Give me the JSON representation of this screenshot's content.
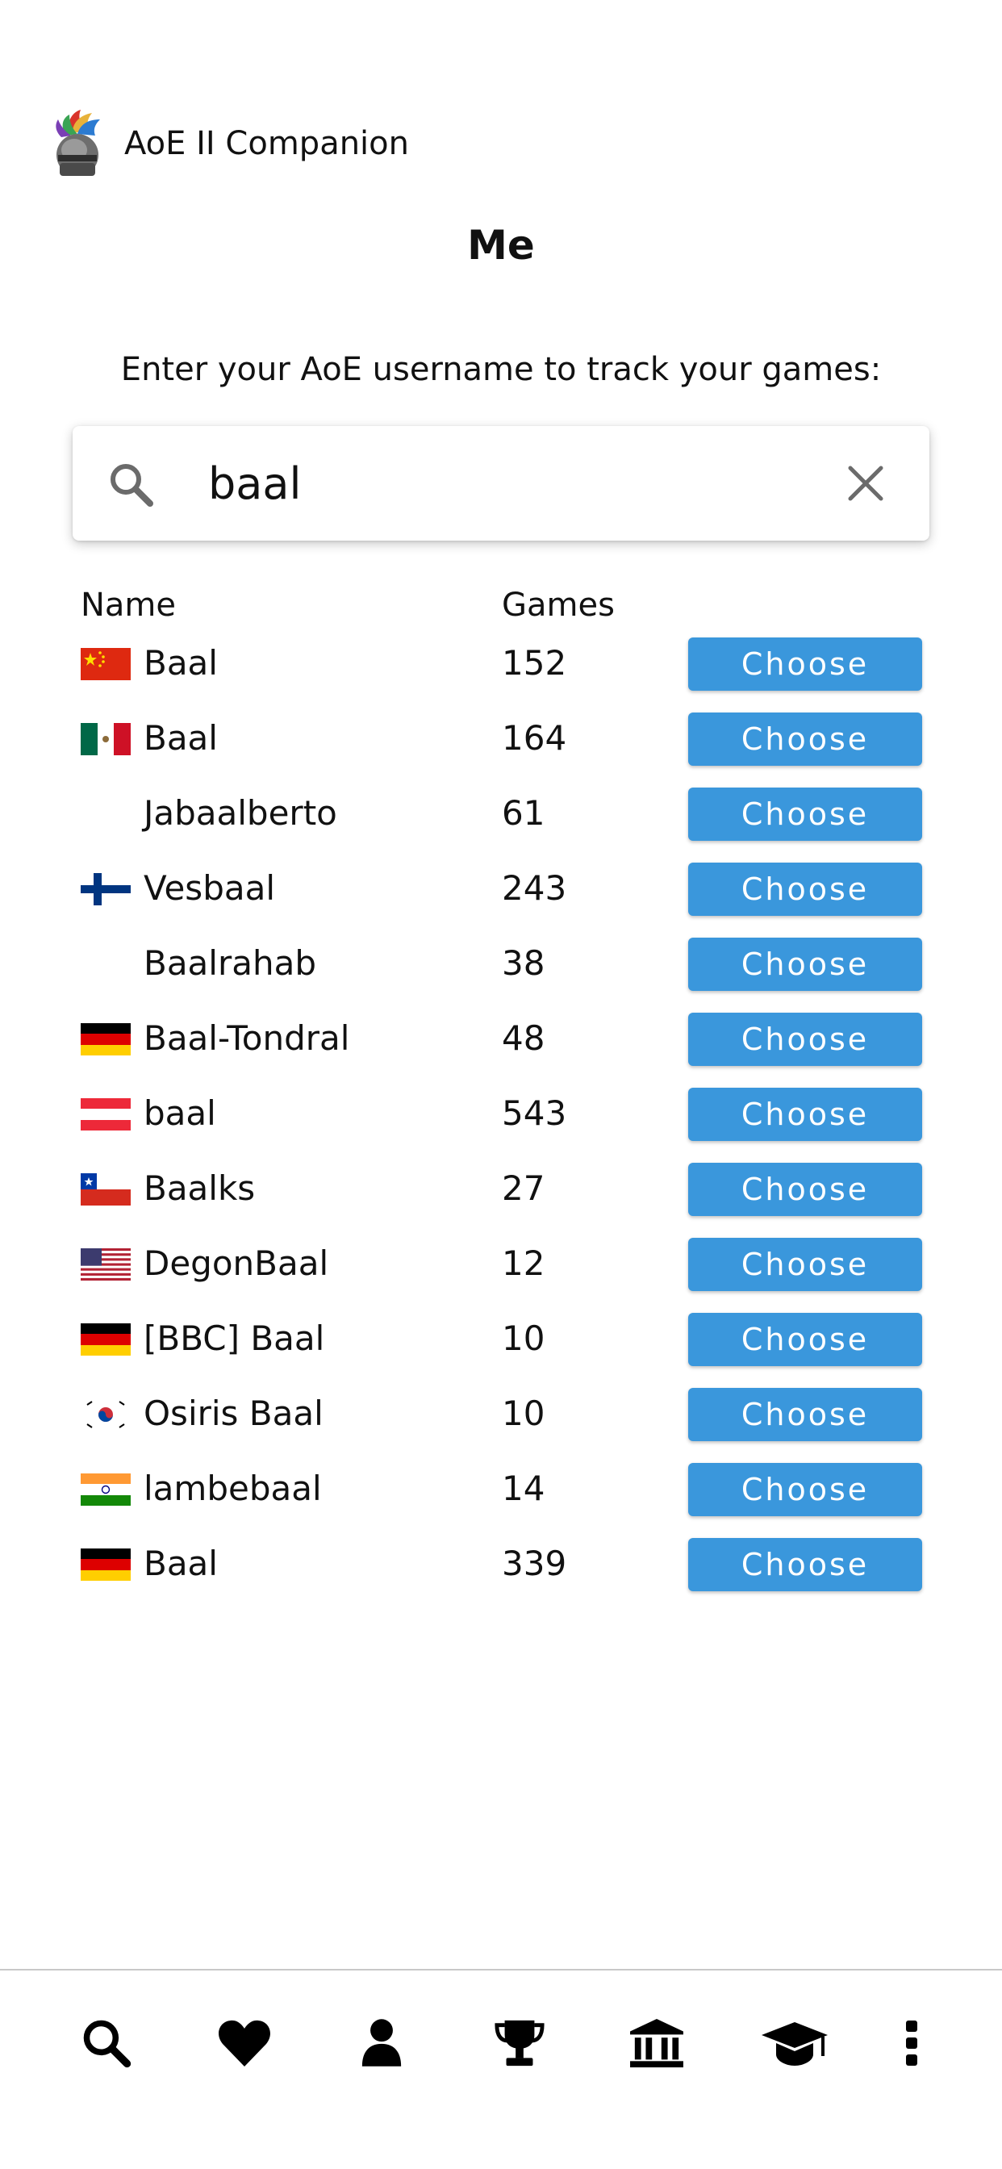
{
  "app": {
    "title": "AoE II Companion",
    "logo_icon": "knight-helmet-icon"
  },
  "page": {
    "title": "Me",
    "instruction": "Enter your AoE username to track your games:"
  },
  "search": {
    "value": "baal",
    "icon": "search-icon",
    "clear_icon": "close-icon"
  },
  "table": {
    "headers": {
      "name": "Name",
      "games": "Games"
    },
    "rows": [
      {
        "flag": "cn",
        "name": "Baal",
        "games": "152",
        "action": "Choose"
      },
      {
        "flag": "mx",
        "name": "Baal",
        "games": "164",
        "action": "Choose"
      },
      {
        "flag": "",
        "name": "Jabaalberto",
        "games": "61",
        "action": "Choose"
      },
      {
        "flag": "fi",
        "name": "Vesbaal",
        "games": "243",
        "action": "Choose"
      },
      {
        "flag": "",
        "name": "Baalrahab",
        "games": "38",
        "action": "Choose"
      },
      {
        "flag": "de",
        "name": "Baal-Tondral",
        "games": "48",
        "action": "Choose"
      },
      {
        "flag": "at",
        "name": "baal",
        "games": "543",
        "action": "Choose"
      },
      {
        "flag": "cl",
        "name": "Baalks",
        "games": "27",
        "action": "Choose"
      },
      {
        "flag": "us",
        "name": "DegonBaal",
        "games": "12",
        "action": "Choose"
      },
      {
        "flag": "de",
        "name": "[BBC] Baal",
        "games": "10",
        "action": "Choose"
      },
      {
        "flag": "kr",
        "name": "Osiris Baal",
        "games": "10",
        "action": "Choose"
      },
      {
        "flag": "in",
        "name": "lambebaal",
        "games": "14",
        "action": "Choose"
      },
      {
        "flag": "de",
        "name": "Baal",
        "games": "339",
        "action": "Choose"
      }
    ]
  },
  "nav": {
    "items": [
      {
        "icon": "search-icon"
      },
      {
        "icon": "heart-icon"
      },
      {
        "icon": "user-icon"
      },
      {
        "icon": "trophy-icon"
      },
      {
        "icon": "museum-icon"
      },
      {
        "icon": "graduation-cap-icon"
      },
      {
        "icon": "more-vertical-icon"
      }
    ]
  },
  "colors": {
    "button": "#3a97dc",
    "button_text": "#ffffff",
    "text": "#111111"
  }
}
